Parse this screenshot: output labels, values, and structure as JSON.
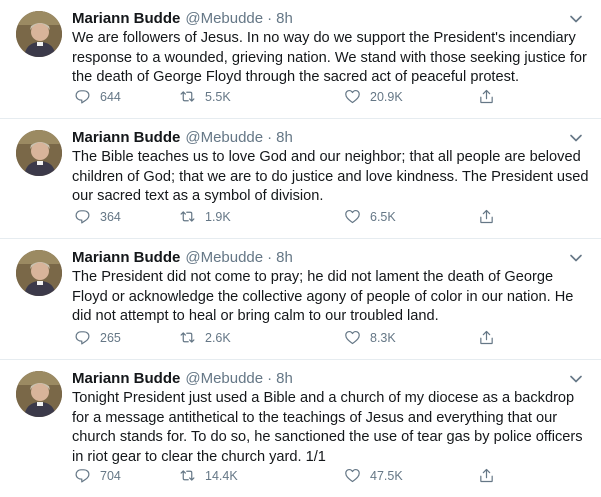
{
  "tweets": [
    {
      "name": "Mariann Budde",
      "handle": "@Mebudde",
      "separator": "·",
      "time": "8h",
      "text": "We are followers of Jesus. In no way do we support the President's incendiary response to a wounded, grieving nation. We stand with those seeking justice for the death of George Floyd through the sacred act of peaceful protest.",
      "replies": "644",
      "retweets": "5.5K",
      "likes": "20.9K"
    },
    {
      "name": "Mariann Budde",
      "handle": "@Mebudde",
      "separator": "·",
      "time": "8h",
      "text": "The Bible teaches us to love God and our neighbor; that all people are beloved children of God; that we are to do justice and love kindness. The President used our sacred text as a symbol of division.",
      "replies": "364",
      "retweets": "1.9K",
      "likes": "6.5K"
    },
    {
      "name": "Mariann Budde",
      "handle": "@Mebudde",
      "separator": "·",
      "time": "8h",
      "text": "The President did not come to pray; he did not lament the death of George Floyd or acknowledge the collective agony of people of color in our nation. He did not attempt to heal or bring calm to our troubled land.",
      "replies": "265",
      "retweets": "2.6K",
      "likes": "8.3K"
    },
    {
      "name": "Mariann Budde",
      "handle": "@Mebudde",
      "separator": "·",
      "time": "8h",
      "text": "Tonight President just used a Bible and a church of my diocese as a backdrop for a message antithetical to the teachings of Jesus and everything that our church stands for. To do so, he sanctioned the use of tear gas by police officers in riot gear to clear the church yard. 1/1",
      "replies": "704",
      "retweets": "14.4K",
      "likes": "47.5K"
    }
  ],
  "icons": {
    "reply": "reply-icon",
    "retweet": "retweet-icon",
    "like": "heart-icon",
    "share": "share-icon",
    "more": "chevron-down-icon",
    "avatar": "avatar"
  },
  "colors": {
    "text": "#14171a",
    "secondary": "#657786",
    "divider": "#e6ecf0"
  }
}
